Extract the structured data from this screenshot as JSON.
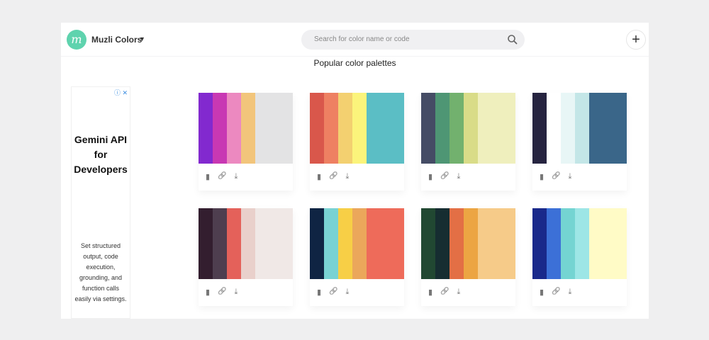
{
  "header": {
    "brand": "Muzli Colors",
    "logo_letter": "m",
    "search_placeholder": "Search for color name or code"
  },
  "page_title": "Popular color palettes",
  "ad": {
    "headline": "Gemini API for Developers",
    "body": "Set structured output, code execution, grounding, and function calls easily via settings."
  },
  "icons": {
    "save": "bookmark-icon",
    "link": "link-icon",
    "download": "download-icon"
  },
  "palettes": [
    [
      "#8229cf",
      "#c838b3",
      "#ec89c0",
      "#f2c57b",
      "#e3e3e4"
    ],
    [
      "#d9574b",
      "#ee8062",
      "#f3d070",
      "#fbf47b",
      "#5bbec5"
    ],
    [
      "#454c65",
      "#4e9674",
      "#72b16e",
      "#d9dc88",
      "#efefbd"
    ],
    [
      "#262440",
      "#ffffff",
      "#e8f6f6",
      "#c3e6e7",
      "#3a6689"
    ],
    [
      "#331e2f",
      "#4e3e4f",
      "#e4615a",
      "#e9d0cb",
      "#f0e8e6"
    ],
    [
      "#0f2443",
      "#79d2d3",
      "#f7cf46",
      "#eba75b",
      "#ee6b5a"
    ],
    [
      "#214832",
      "#162d31",
      "#e36f45",
      "#eca543",
      "#f6cb89"
    ],
    [
      "#19298b",
      "#3c70d7",
      "#74d4d2",
      "#9de6e6",
      "#fffbc6"
    ]
  ]
}
